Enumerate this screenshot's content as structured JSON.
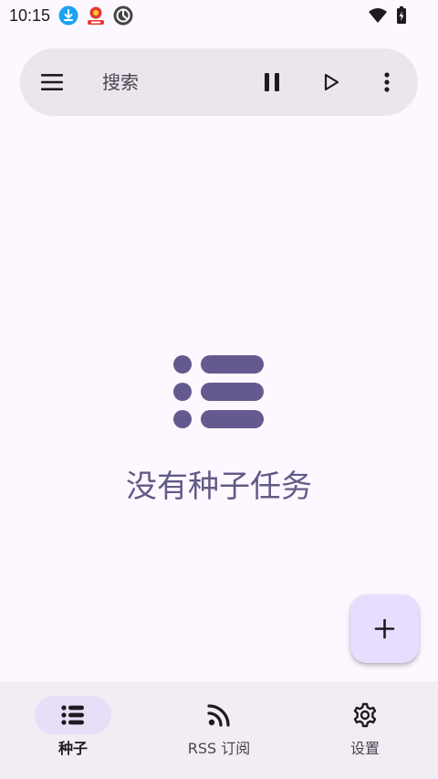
{
  "status_bar": {
    "time": "10:15",
    "icons": [
      "download-icon",
      "app-notification-icon",
      "data-saver-icon",
      "wifi-icon",
      "battery-icon"
    ]
  },
  "search_bar": {
    "placeholder": "搜索",
    "icons": [
      "menu-icon",
      "pause-icon",
      "play-icon",
      "more-vert-icon"
    ]
  },
  "empty_state": {
    "message": "没有种子任务",
    "icon": "list-icon"
  },
  "fab": {
    "icon": "add-icon"
  },
  "bottom_nav": {
    "items": [
      {
        "label": "种子",
        "icon": "list-icon",
        "active": true
      },
      {
        "label": "RSS 订阅",
        "icon": "rss-icon",
        "active": false
      },
      {
        "label": "设置",
        "icon": "settings-icon",
        "active": false
      }
    ]
  },
  "colors": {
    "background": "#fdf7ff",
    "search_bar": "#ebe6ee",
    "accent": "#625b86",
    "fab": "#e9ddff",
    "nav_background": "#f2ecf4",
    "nav_active_pill": "#e8def8"
  }
}
